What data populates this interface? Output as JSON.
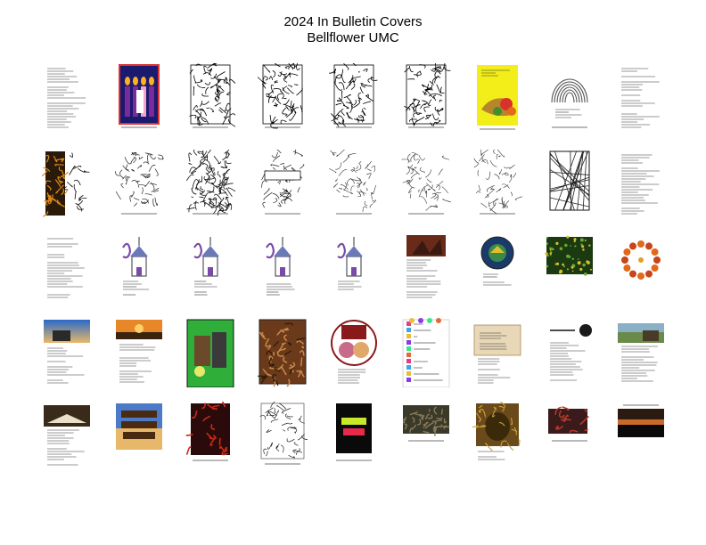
{
  "title": {
    "line1": "2024 In Bulletin Covers",
    "line2": "Bellflower UMC"
  },
  "covers": [
    {
      "style": "text"
    },
    {
      "style": "advent-candles"
    },
    {
      "style": "line-art"
    },
    {
      "style": "line-art"
    },
    {
      "style": "line-art"
    },
    {
      "style": "line-art"
    },
    {
      "style": "cornucopia"
    },
    {
      "style": "rainbow-hands"
    },
    {
      "style": "text"
    },
    {
      "style": "stained-glass-dark"
    },
    {
      "style": "sketch"
    },
    {
      "style": "sketch-dense"
    },
    {
      "style": "sketch-banner"
    },
    {
      "style": "sketch-light"
    },
    {
      "style": "sketch-light"
    },
    {
      "style": "sketch-light"
    },
    {
      "style": "window-lines"
    },
    {
      "style": "text"
    },
    {
      "style": "text"
    },
    {
      "style": "church-music"
    },
    {
      "style": "church-music"
    },
    {
      "style": "church-music"
    },
    {
      "style": "church-music"
    },
    {
      "style": "hands-photo"
    },
    {
      "style": "badge"
    },
    {
      "style": "green-photo"
    },
    {
      "style": "flower-ring"
    },
    {
      "style": "sky-photo"
    },
    {
      "style": "sunset-photo"
    },
    {
      "style": "green-cartoon"
    },
    {
      "style": "painting"
    },
    {
      "style": "family-circle"
    },
    {
      "style": "color-letters"
    },
    {
      "style": "card-beige"
    },
    {
      "style": "text-apple"
    },
    {
      "style": "landscape-photo"
    },
    {
      "style": "book-photo"
    },
    {
      "style": "thy-will"
    },
    {
      "style": "dark-red"
    },
    {
      "style": "palm-sketch"
    },
    {
      "style": "who-am-i"
    },
    {
      "style": "crowd-photo"
    },
    {
      "style": "face-art"
    },
    {
      "style": "red-dark"
    },
    {
      "style": "night-silhouette"
    }
  ],
  "colors": {
    "background": "#ffffff",
    "text": "#000000"
  }
}
